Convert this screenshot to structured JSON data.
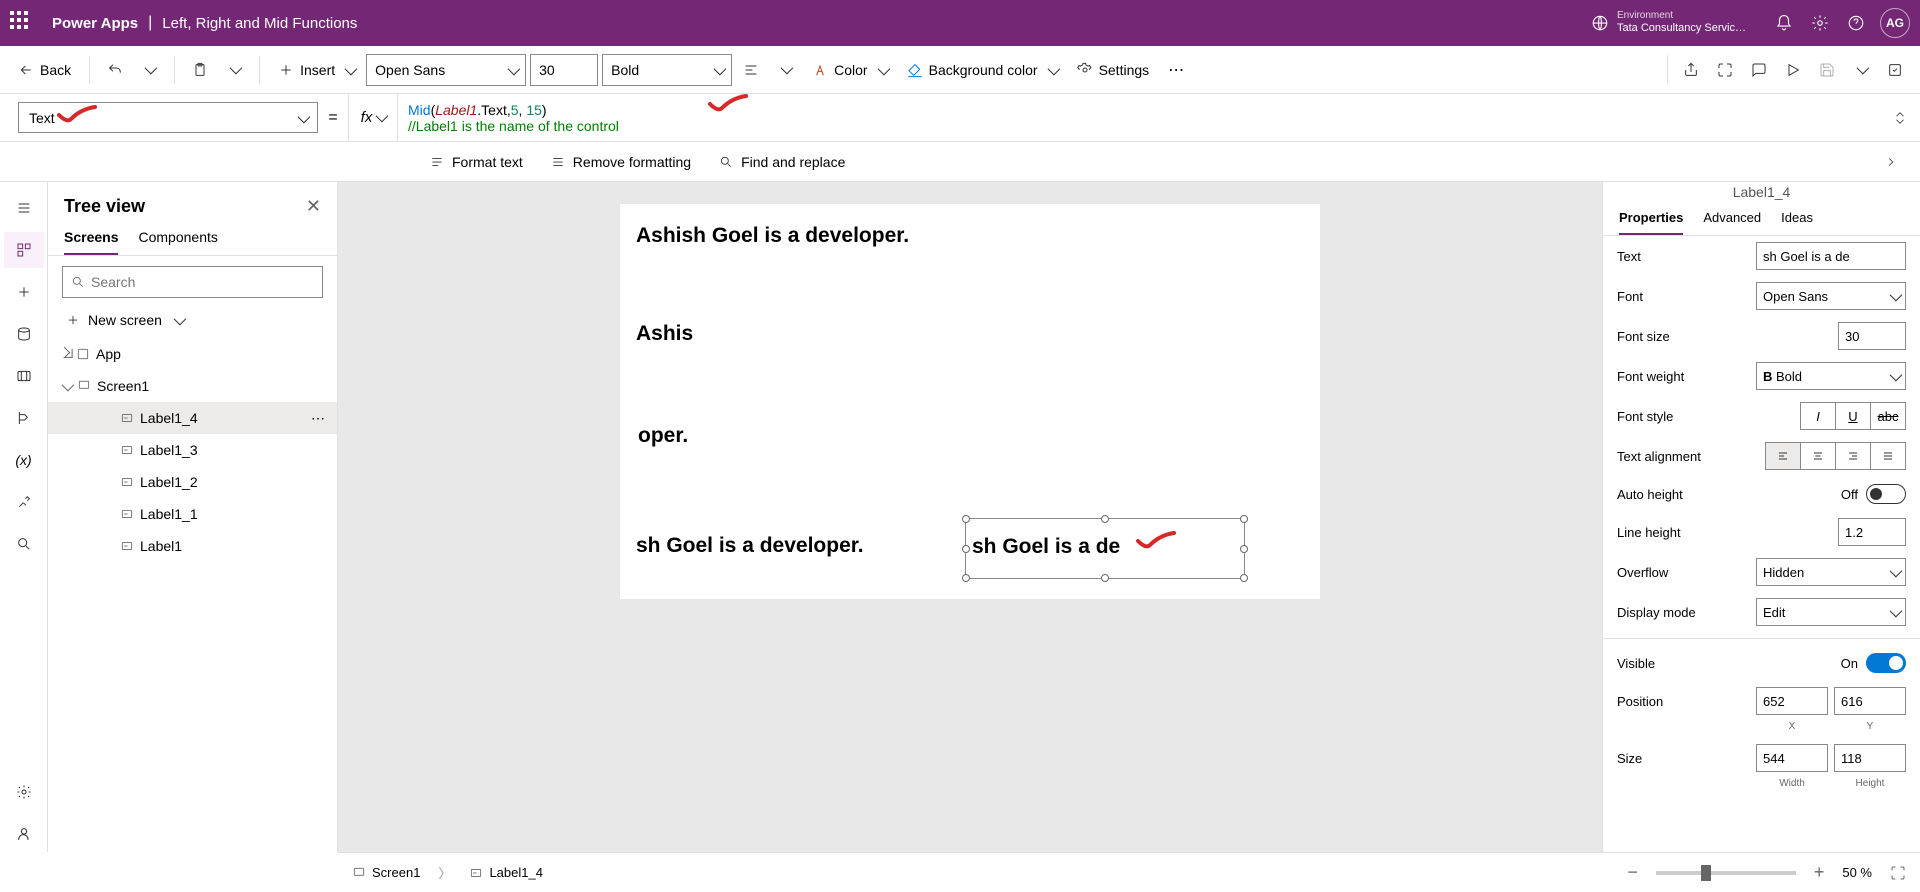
{
  "header": {
    "app": "Power Apps",
    "title": "Left, Right and Mid Functions",
    "env_label": "Environment",
    "env_name": "Tata Consultancy Servic…",
    "avatar": "AG"
  },
  "cmdbar": {
    "back": "Back",
    "insert": "Insert",
    "font": "Open Sans",
    "font_size": "30",
    "font_weight": "Bold",
    "color": "Color",
    "bgcolor": "Background color",
    "settings": "Settings"
  },
  "formula": {
    "property": "Text",
    "fx": "fx",
    "code_func": "Mid",
    "code_ident": "Label1",
    "code_rest1": ".Text,",
    "code_num1": "5",
    "code_mid": ", ",
    "code_num2": "15",
    "code_end": ")",
    "comment": "//Label1 is the name of the control"
  },
  "toolbar": {
    "format": "Format text",
    "remove": "Remove formatting",
    "find": "Find and replace"
  },
  "tree": {
    "title": "Tree view",
    "tab_screens": "Screens",
    "tab_components": "Components",
    "search_placeholder": "Search",
    "new_screen": "New screen",
    "app": "App",
    "screen": "Screen1",
    "items": [
      "Label1_4",
      "Label1_3",
      "Label1_2",
      "Label1_1",
      "Label1"
    ]
  },
  "canvas": {
    "lbl1": "Ashish Goel is a developer.",
    "lbl2": "Ashis",
    "lbl3": "oper.",
    "lbl4": "sh Goel is a developer.",
    "lbl5": "sh Goel is a de"
  },
  "props": {
    "selected_name": "Label1_4",
    "tab_props": "Properties",
    "tab_adv": "Advanced",
    "tab_ideas": "Ideas",
    "text_label": "Text",
    "text_value": "sh Goel is a de",
    "font_label": "Font",
    "font_value": "Open Sans",
    "fontsize_label": "Font size",
    "fontsize_value": "30",
    "fontweight_label": "Font weight",
    "fontweight_value": "Bold",
    "fontstyle_label": "Font style",
    "align_label": "Text alignment",
    "autoheight_label": "Auto height",
    "autoheight_value": "Off",
    "lineheight_label": "Line height",
    "lineheight_value": "1.2",
    "overflow_label": "Overflow",
    "overflow_value": "Hidden",
    "displaymode_label": "Display mode",
    "displaymode_value": "Edit",
    "visible_label": "Visible",
    "visible_value": "On",
    "position_label": "Position",
    "position_x": "652",
    "position_y": "616",
    "position_xl": "X",
    "position_yl": "Y",
    "size_label": "Size",
    "size_w": "544",
    "size_h": "118",
    "size_wl": "Width",
    "size_hl": "Height"
  },
  "status": {
    "screen": "Screen1",
    "label": "Label1_4",
    "zoom": "50 %"
  }
}
